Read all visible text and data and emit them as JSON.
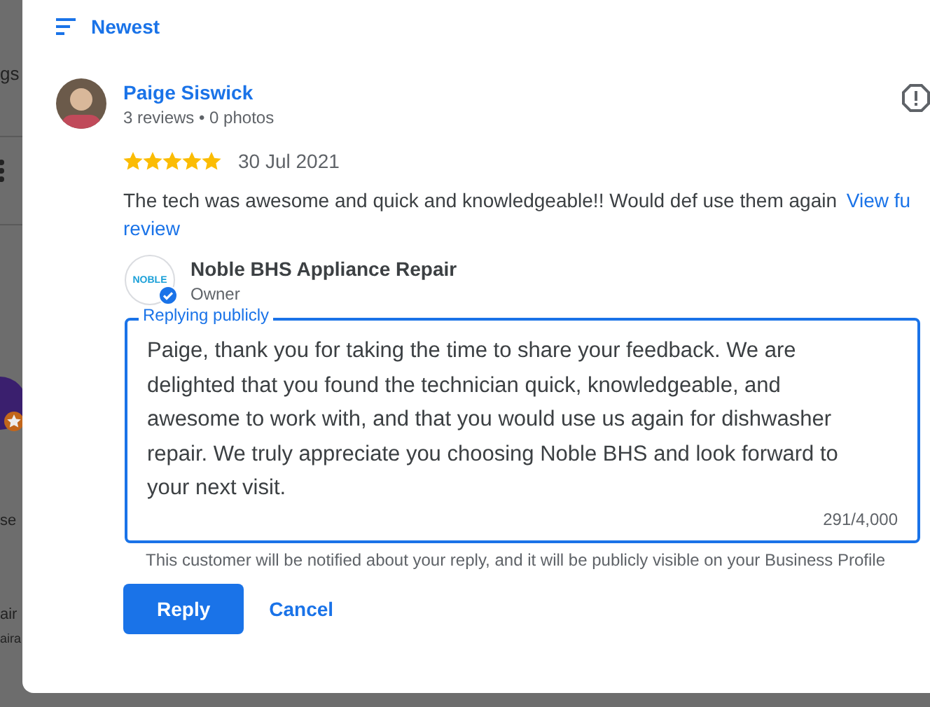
{
  "background": {
    "fragments": [
      "gs",
      "se",
      "air",
      "aira"
    ]
  },
  "sort": {
    "label": "Newest"
  },
  "review": {
    "author": "Paige Siswick",
    "meta": "3 reviews • 0 photos",
    "stars": 5,
    "date": "30 Jul 2021",
    "text": "The tech was awesome and quick and knowledgeable!! Would def use them again",
    "link_lines": [
      "View fu",
      "review"
    ]
  },
  "owner": {
    "logo_text": "NOBLE",
    "verified": true,
    "name": "Noble BHS Appliance Repair",
    "role": "Owner"
  },
  "reply_field": {
    "label": "Replying publicly",
    "value": "Paige, thank you for taking the time to share your feedback. We are delighted that you found the technician quick, knowledgeable, and awesome to work with, and that you would use us again for dishwasher repair. We truly appreciate you choosing Noble BHS and look forward to your next visit.",
    "counter": "291/4,000"
  },
  "notice": "This customer will be notified about your reply, and it will be publicly visible on your Business Profile",
  "buttons": [
    {
      "kind": "primary",
      "label": "Reply"
    },
    {
      "kind": "text",
      "label": "Cancel"
    }
  ]
}
